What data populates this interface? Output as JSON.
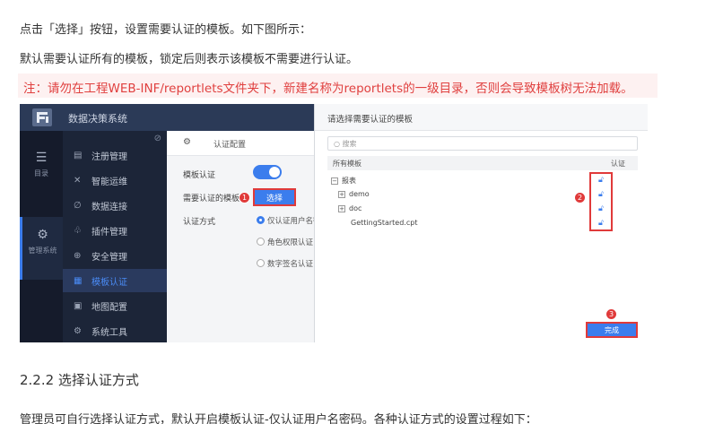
{
  "doc": {
    "para1": "点击「选择」按钮，设置需要认证的模板。如下图所示：",
    "para2": "默认需要认证所有的模板，锁定后则表示该模板不需要进行认证。",
    "note": "注：请勿在工程WEB-INF/reportlets文件夹下，新建名称为reportlets的一级目录，否则会导致模板树无法加载。",
    "heading": "2.2.2 选择认证方式",
    "para3": "管理员可自行选择认证方式，默认开启模板认证-仅认证用户名密码。各种认证方式的设置过程如下："
  },
  "screenshot": {
    "app_title": "数据决策系统",
    "icon_col": [
      {
        "icon": "list-icon",
        "label": "目录"
      },
      {
        "icon": "gear-icon",
        "label": "管理系统"
      }
    ],
    "menu": [
      {
        "icon": "register-icon",
        "label": "注册管理"
      },
      {
        "icon": "ops-icon",
        "label": "智能运维"
      },
      {
        "icon": "link-icon",
        "label": "数据连接"
      },
      {
        "icon": "plugin-icon",
        "label": "插件管理"
      },
      {
        "icon": "shield-icon",
        "label": "安全管理"
      },
      {
        "icon": "template-auth-icon",
        "label": "模板认证",
        "active": true
      },
      {
        "icon": "map-icon",
        "label": "地图配置"
      },
      {
        "icon": "tools-icon",
        "label": "系统工具"
      }
    ],
    "config": {
      "header": "认证配置",
      "template_auth_label": "模板认证",
      "template_auth_enabled": true,
      "need_auth_label": "需要认证的模板",
      "select_button": "选择",
      "auth_method_label": "认证方式",
      "options": [
        "仅认证用户名密",
        "角色权限认证",
        "数字签名认证"
      ],
      "selected_option": 0
    },
    "dialog": {
      "title": "请选择需要认证的模板",
      "search_placeholder": "搜索",
      "col_all": "所有模板",
      "col_auth": "认证",
      "tree": [
        {
          "expander": "−",
          "label": "报表",
          "level": 0
        },
        {
          "expander": "+",
          "label": "demo",
          "level": 1
        },
        {
          "expander": "+",
          "label": "doc",
          "level": 1
        },
        {
          "expander": "",
          "label": "GettingStarted.cpt",
          "level": 1
        }
      ],
      "done_button": "完成"
    },
    "badges": [
      "1",
      "2",
      "3"
    ],
    "colors": {
      "accent": "#3b7ded",
      "highlight": "#e03a3a",
      "note_text": "#e0403f"
    }
  }
}
